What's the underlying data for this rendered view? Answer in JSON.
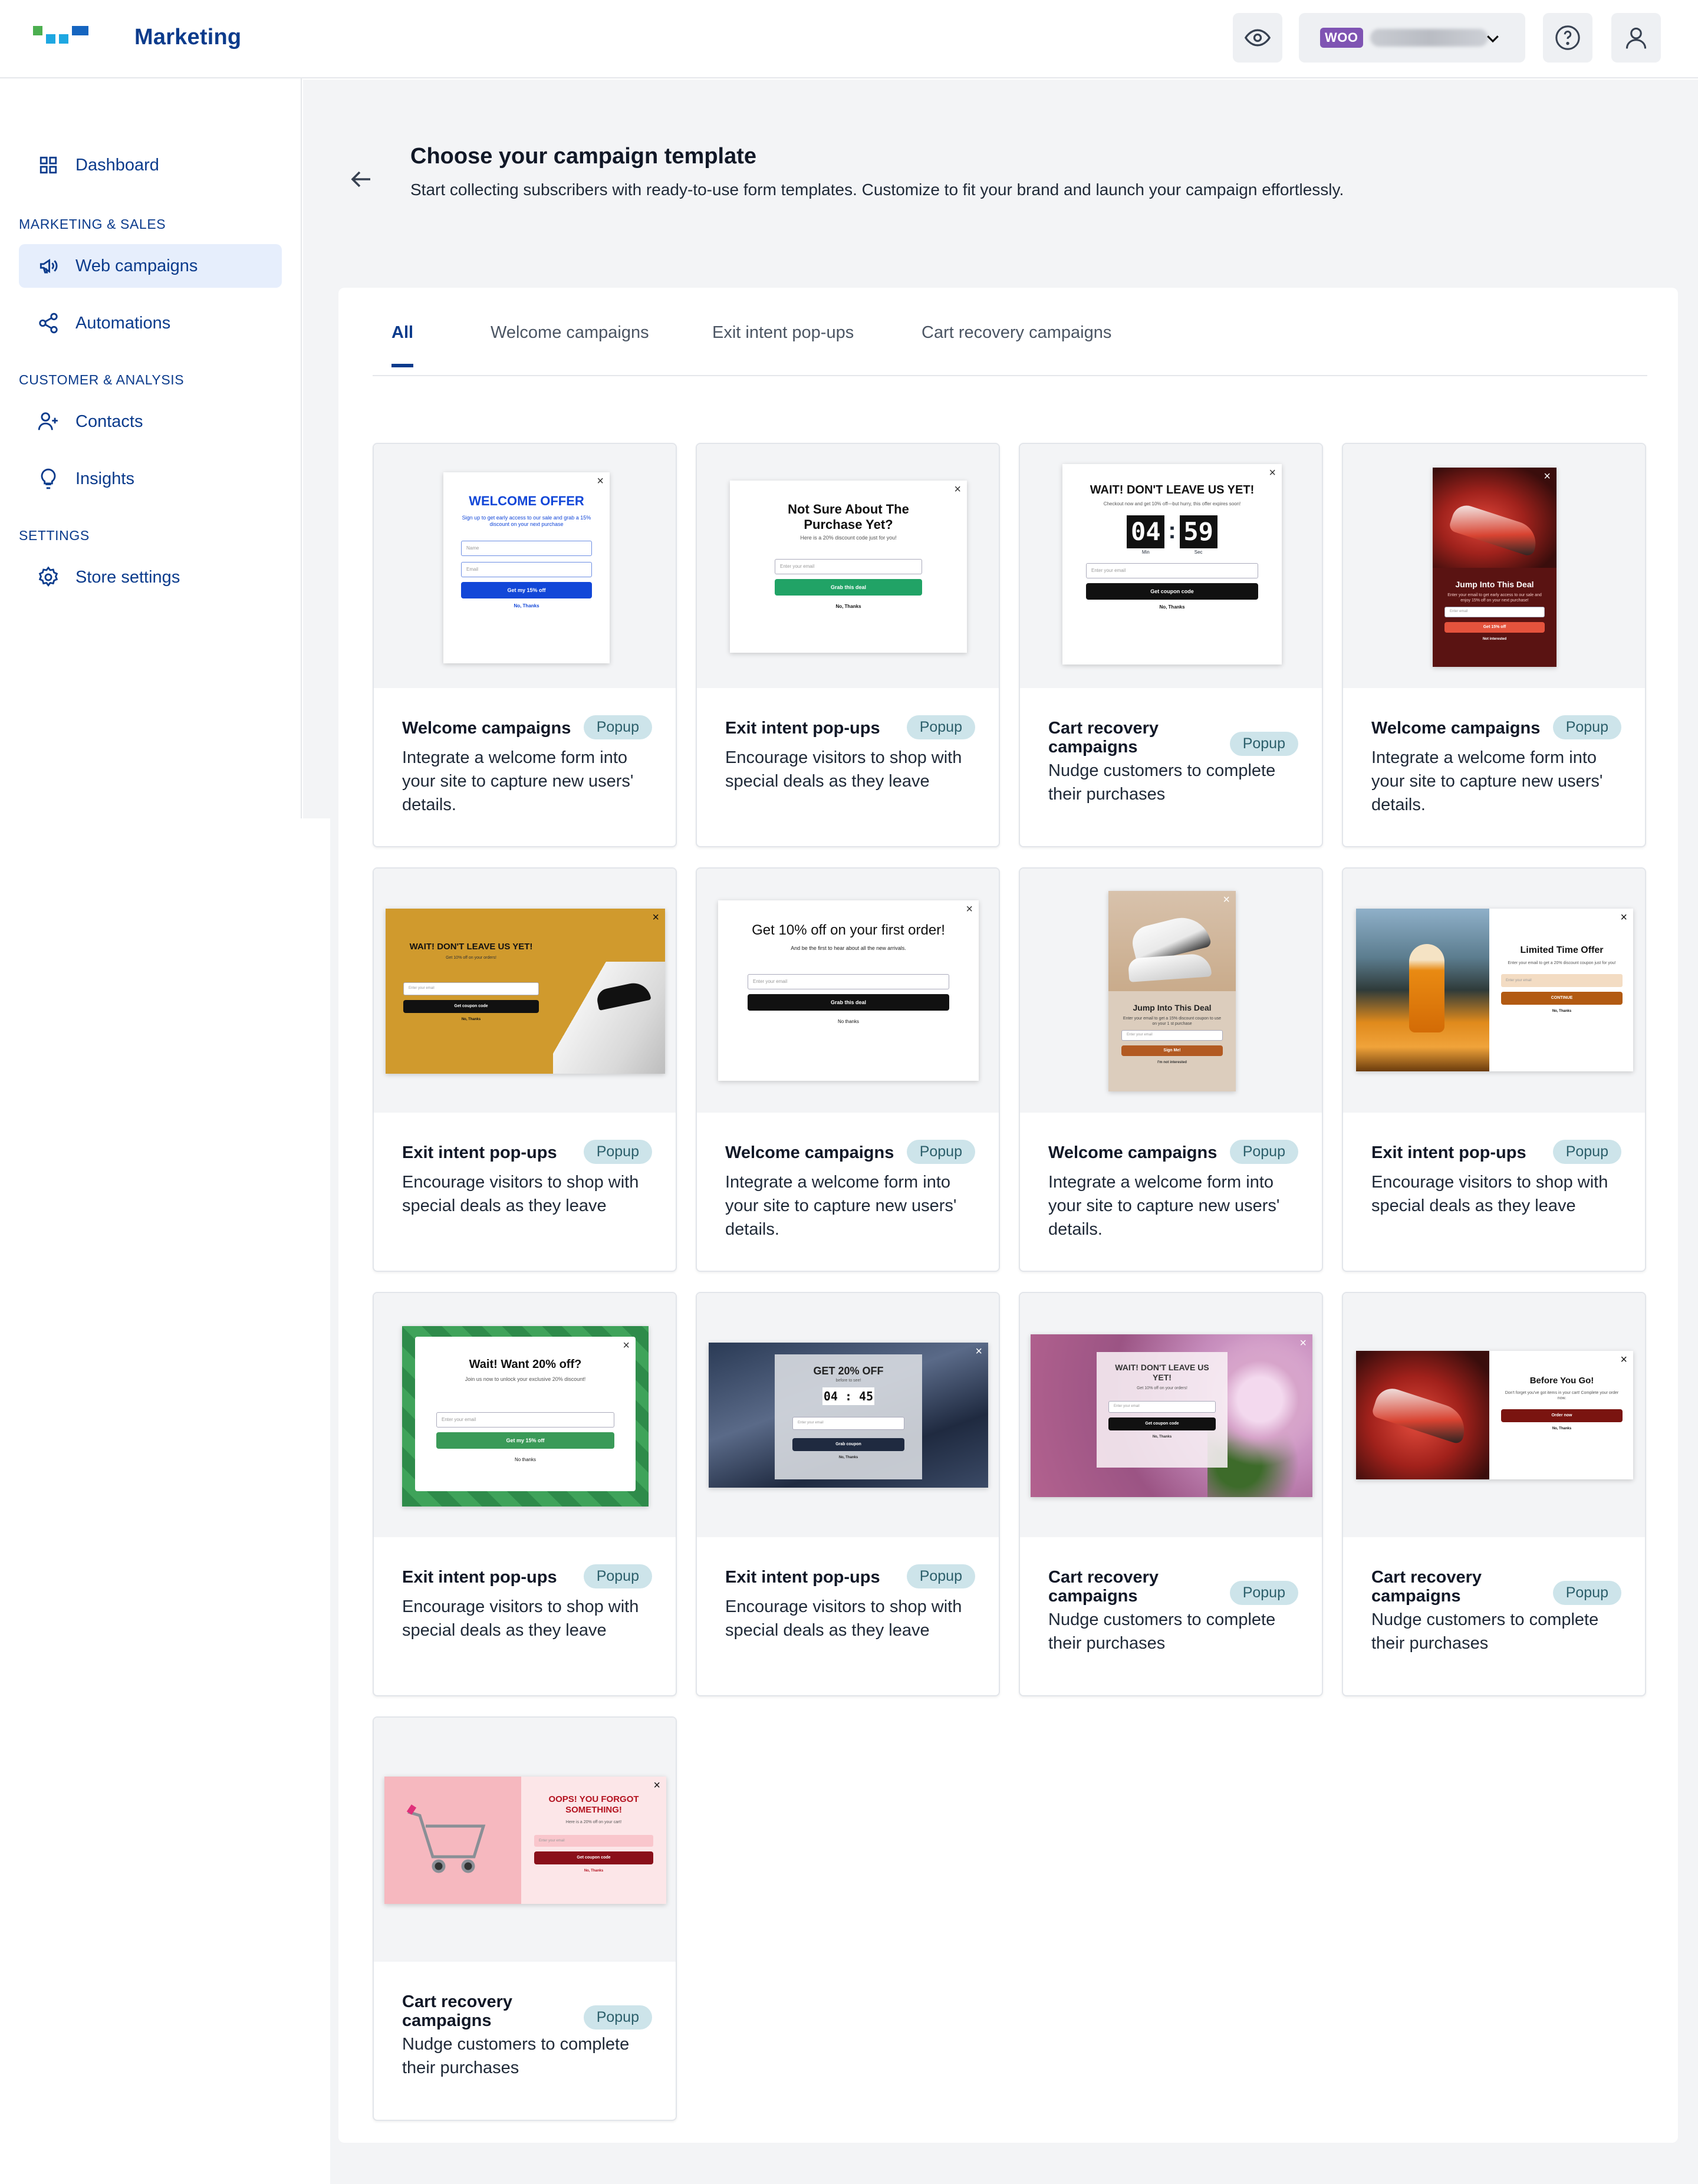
{
  "app": {
    "name": "Marketing",
    "store_badge": "WOO"
  },
  "sidebar": {
    "dashboard": "Dashboard",
    "section_marketing": "MARKETING & SALES",
    "web_campaigns": "Web campaigns",
    "automations": "Automations",
    "section_customer": "CUSTOMER & ANALYSIS",
    "contacts": "Contacts",
    "insights": "Insights",
    "section_settings": "SETTINGS",
    "store_settings": "Store settings"
  },
  "page": {
    "title": "Choose your campaign template",
    "subtitle": "Start collecting subscribers with ready-to-use form templates. Customize to fit your brand and launch your campaign effortlessly."
  },
  "tabs": [
    "All",
    "Welcome campaigns",
    "Exit intent pop-ups",
    "Cart recovery campaigns"
  ],
  "badge_label": "Popup",
  "cards": [
    {
      "title": "Welcome campaigns",
      "desc": "Integrate a welcome form into your site to capture new users' details."
    },
    {
      "title": "Exit intent pop-ups",
      "desc": "Encourage visitors to shop with special deals as they leave"
    },
    {
      "title": "Cart recovery campaigns",
      "desc": "Nudge customers to complete their purchases"
    },
    {
      "title": "Welcome campaigns",
      "desc": "Integrate a welcome form into your site to capture new users' details."
    },
    {
      "title": "Exit intent pop-ups",
      "desc": "Encourage visitors to shop with special deals as they leave"
    },
    {
      "title": "Welcome campaigns",
      "desc": "Integrate a welcome form into your site to capture new users' details."
    },
    {
      "title": "Welcome campaigns",
      "desc": "Integrate a welcome form into your site to capture new users' details."
    },
    {
      "title": "Exit intent pop-ups",
      "desc": "Encourage visitors to shop with special deals as they leave"
    },
    {
      "title": "Exit intent pop-ups",
      "desc": "Encourage visitors to shop with special deals as they leave"
    },
    {
      "title": "Exit intent pop-ups",
      "desc": "Encourage visitors to shop with special deals as they leave"
    },
    {
      "title": "Cart recovery campaigns",
      "desc": "Nudge customers to complete their purchases"
    },
    {
      "title": "Cart recovery campaigns",
      "desc": "Nudge customers to complete their purchases"
    },
    {
      "title": "Cart recovery campaigns",
      "desc": "Nudge customers to complete their purchases"
    }
  ],
  "previews": {
    "p1": {
      "title": "WELCOME OFFER",
      "text": "Sign up to get early access to our sale and grab a 15% discount on your next purchase",
      "name": "Name",
      "email": "Email",
      "btn": "Get my 15% off",
      "no": "No, Thanks"
    },
    "p2": {
      "title": "Not Sure About The Purchase Yet?",
      "text": "Here is a 20% discount code just for you!",
      "email": "Enter your email",
      "btn": "Grab this deal",
      "no": "No, Thanks"
    },
    "p3": {
      "title": "WAIT! DON'T LEAVE US YET!",
      "text": "Checkout now and get 10% off—but hurry, this offer expires soon!",
      "min": "04",
      "sec": "59",
      "min_l": "Min",
      "sec_l": "Sec",
      "email": "Enter your email",
      "btn": "Get coupon code",
      "no": "No, Thanks"
    },
    "p4": {
      "title": "Jump Into This Deal",
      "text": "Enter your email to get early access to our sale and enjoy 15% off on your next purchase!",
      "email": "Enter email",
      "btn": "Get 15% off",
      "no": "Not interested"
    },
    "p5": {
      "title": "WAIT! DON'T LEAVE US YET!",
      "text": "Get 10% off on your orders!",
      "email": "Enter your email",
      "btn": "Get coupon code",
      "no": "No, Thanks"
    },
    "p6": {
      "title": "Get 10% off on your first order!",
      "text": "And be the first to hear about all the new arrivals.",
      "email": "Enter your email",
      "btn": "Grab this deal",
      "no": "No thanks"
    },
    "p7": {
      "title": "Jump Into This Deal",
      "text": "Enter your email to get a 15% discount coupon to use on your 1 st purchase",
      "email": "Enter your email",
      "btn": "Sign Me!",
      "no": "I'm not interested"
    },
    "p8": {
      "title": "Limited Time Offer",
      "text": "Enter your email to get a 20% discount coupon just for you!",
      "email": "Enter your email",
      "btn": "CONTINUE",
      "no": "No, Thanks"
    },
    "p9": {
      "title": "Wait! Want 20% off?",
      "text": "Join us now to unlock your exclusive 20% discount!",
      "email": "Enter your email",
      "btn": "Get my 15% off",
      "no": "No thanks"
    },
    "p10": {
      "title": "GET 20% OFF",
      "text": "before to see!",
      "timer": "04 : 45",
      "email": "Enter your email",
      "btn": "Grab coupon",
      "no": "No, Thanks"
    },
    "p11": {
      "title": "WAIT! DON'T LEAVE US YET!",
      "text": "Get 10% off on your orders!",
      "email": "Enter your email",
      "btn": "Get coupon code",
      "no": "No, Thanks"
    },
    "p12": {
      "title": "Before You Go!",
      "text": "Don't forget you've got items in your cart! Complete your order now.",
      "btn": "Order now",
      "no": "No, Thanks"
    },
    "p13": {
      "title": "OOPS! YOU FORGOT SOMETHING!",
      "text": "Here is a 20% off on your cart!",
      "email": "Enter your email",
      "btn": "Get coupon code",
      "no": "No, Thanks"
    }
  },
  "colors": {
    "brand": "#0b3b8c",
    "logo_green": "#4caf50",
    "logo_cyan": "#1ea7e1",
    "logo_blue": "#1565c0",
    "badge_bg": "#cde4ea"
  }
}
